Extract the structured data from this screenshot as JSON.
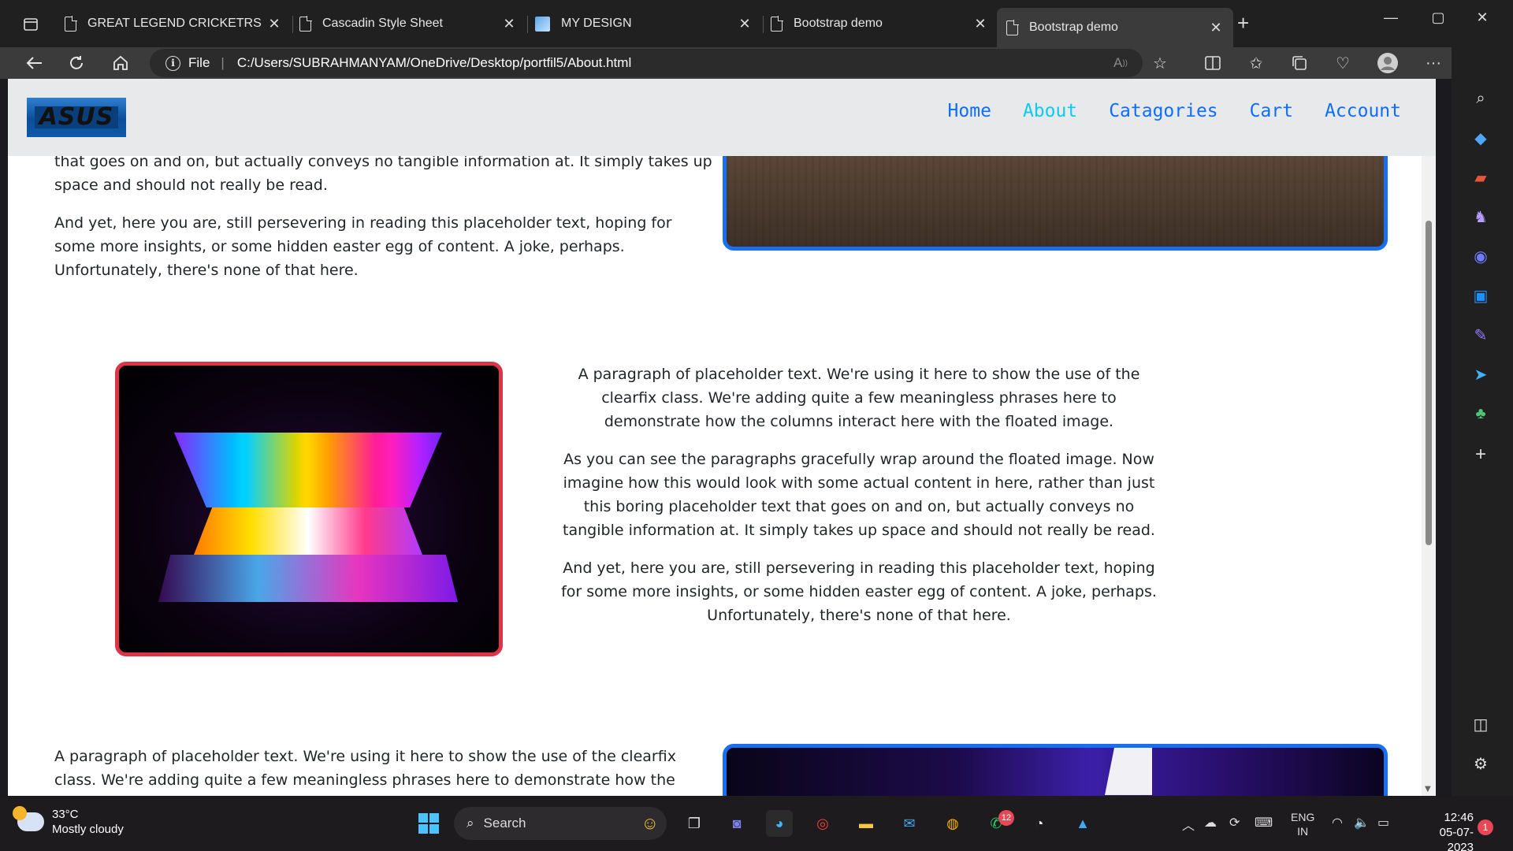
{
  "browser": {
    "tabs": [
      {
        "title": "GREAT LEGEND CRICKETRS",
        "icon": "doc-icon",
        "active": false
      },
      {
        "title": "Cascadin Style Sheet",
        "icon": "doc-icon",
        "active": false
      },
      {
        "title": "MY DESIGN",
        "icon": "image-icon",
        "active": false
      },
      {
        "title": "Bootstrap demo",
        "icon": "doc-icon",
        "active": false
      },
      {
        "title": "Bootstrap demo",
        "icon": "doc-icon",
        "active": true
      }
    ],
    "address": {
      "scheme_label": "File",
      "url": "C:/Users/SUBRAHMANYAM/OneDrive/Desktop/portfil5/About.html"
    }
  },
  "site": {
    "logo_text": "ASUS",
    "nav": {
      "home": "Home",
      "about": "About",
      "categories": "Catagories",
      "cart": "Cart",
      "account": "Account"
    },
    "section1": {
      "p1": "that goes on and on, but actually conveys no tangible information at. It simply takes up space and should not really be read.",
      "p2": "And yet, here you are, still persevering in reading this placeholder text, hoping for some more insights, or some hidden easter egg of content. A joke, perhaps. Unfortunately, there's none of that here."
    },
    "section2": {
      "p1": "A paragraph of placeholder text. We're using it here to show the use of the clearfix class. We're adding quite a few meaningless phrases here to demonstrate how the columns interact here with the floated image.",
      "p2": "As you can see the paragraphs gracefully wrap around the floated image. Now imagine how this would look with some actual content in here, rather than just this boring placeholder text that goes on and on, but actually conveys no tangible information at. It simply takes up space and should not really be read.",
      "p3": "And yet, here you are, still persevering in reading this placeholder text, hoping for some more insights, or some hidden easter egg of content. A joke, perhaps. Unfortunately, there's none of that here."
    },
    "section3": {
      "p1": "A paragraph of placeholder text. We're using it here to show the use of the clearfix class. We're adding quite a few meaningless phrases here to demonstrate how the columns interact"
    },
    "colors": {
      "nav_link": "#0d6efd",
      "nav_active": "#0dcaf0",
      "frame_blue": "#1a6ff0",
      "frame_red": "#dc3545"
    }
  },
  "taskbar": {
    "weather": {
      "temp": "33°C",
      "desc": "Mostly cloudy"
    },
    "search_label": "Search",
    "whatsapp_badge": "12",
    "lang": {
      "primary": "ENG",
      "secondary": "IN"
    },
    "time": "12:46",
    "date": "05-07-2023",
    "notifications": "1"
  }
}
